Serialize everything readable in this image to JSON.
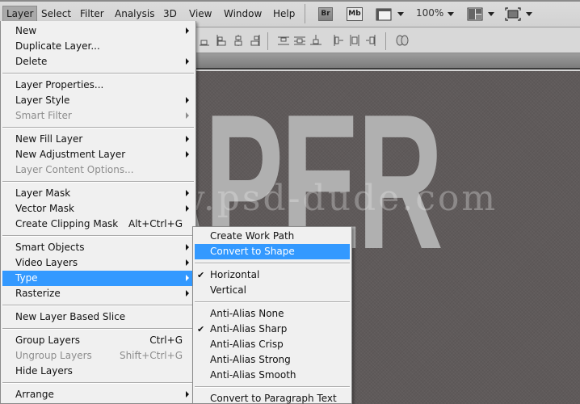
{
  "menubar": {
    "items": [
      {
        "label": "Layer",
        "active": true
      },
      {
        "label": "Select"
      },
      {
        "label": "Filter"
      },
      {
        "label": "Analysis"
      },
      {
        "label": "3D"
      },
      {
        "label": "View"
      },
      {
        "label": "Window"
      },
      {
        "label": "Help"
      }
    ],
    "bridge_label": "Br",
    "minibridge_label": "Mb",
    "zoom_level": "100%"
  },
  "canvas": {
    "big_text": "APER",
    "watermark": "www.psd-dude.com"
  },
  "layer_menu": {
    "items": [
      {
        "label": "New",
        "submenu": true
      },
      {
        "label": "Duplicate Layer..."
      },
      {
        "label": "Delete",
        "submenu": true
      },
      {
        "separator": true
      },
      {
        "label": "Layer Properties..."
      },
      {
        "label": "Layer Style",
        "submenu": true
      },
      {
        "label": "Smart Filter",
        "submenu": true,
        "disabled": true
      },
      {
        "separator": true
      },
      {
        "label": "New Fill Layer",
        "submenu": true
      },
      {
        "label": "New Adjustment Layer",
        "submenu": true
      },
      {
        "label": "Layer Content Options...",
        "disabled": true
      },
      {
        "separator": true
      },
      {
        "label": "Layer Mask",
        "submenu": true
      },
      {
        "label": "Vector Mask",
        "submenu": true
      },
      {
        "label": "Create Clipping Mask",
        "shortcut": "Alt+Ctrl+G"
      },
      {
        "separator": true
      },
      {
        "label": "Smart Objects",
        "submenu": true
      },
      {
        "label": "Video Layers",
        "submenu": true
      },
      {
        "label": "Type",
        "submenu": true,
        "highlighted": true
      },
      {
        "label": "Rasterize",
        "submenu": true
      },
      {
        "separator": true
      },
      {
        "label": "New Layer Based Slice"
      },
      {
        "separator": true
      },
      {
        "label": "Group Layers",
        "shortcut": "Ctrl+G"
      },
      {
        "label": "Ungroup Layers",
        "shortcut": "Shift+Ctrl+G",
        "disabled": true
      },
      {
        "label": "Hide Layers"
      },
      {
        "separator": true
      },
      {
        "label": "Arrange",
        "submenu": true
      }
    ]
  },
  "type_menu": {
    "items": [
      {
        "label": "Create Work Path"
      },
      {
        "label": "Convert to Shape",
        "highlighted": true
      },
      {
        "separator": true
      },
      {
        "label": "Horizontal",
        "checked": true
      },
      {
        "label": "Vertical"
      },
      {
        "separator": true
      },
      {
        "label": "Anti-Alias None"
      },
      {
        "label": "Anti-Alias Sharp",
        "checked": true
      },
      {
        "label": "Anti-Alias Crisp"
      },
      {
        "label": "Anti-Alias Strong"
      },
      {
        "label": "Anti-Alias Smooth"
      },
      {
        "separator": true
      },
      {
        "label": "Convert to Paragraph Text"
      }
    ]
  },
  "colors": {
    "highlight": "#3399ff",
    "menu_bg": "#f0f0f0",
    "disabled_text": "#8d8d8d",
    "canvas_bg": "#5f5a5a",
    "big_text": "#b0b0b0"
  }
}
